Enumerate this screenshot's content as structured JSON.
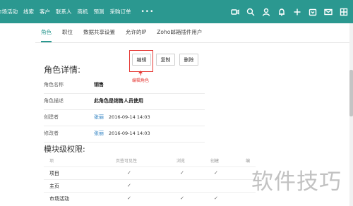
{
  "nav": {
    "items": [
      "市场活动",
      "线索",
      "客户",
      "联系人",
      "商机",
      "预测",
      "采购订单"
    ],
    "more": "•••",
    "icons": [
      "video-icon",
      "search-icon",
      "user-icon",
      "bell-icon",
      "plus-icon",
      "calendar-icon",
      "mail-icon",
      "grid-icon"
    ]
  },
  "tabs": [
    "角色",
    "职位",
    "数据共享设置",
    "允许的IP",
    "Zoho邮箱插件用户"
  ],
  "actions": {
    "edit": "编辑",
    "copy": "复制",
    "delete": "删除",
    "annotation": "编辑角色"
  },
  "details": {
    "title": "角色详情:",
    "rows": [
      {
        "label": "角色名称",
        "value": "销售"
      },
      {
        "label": "角色描述",
        "value": "此角色是销售人员使用"
      },
      {
        "label": "创建者",
        "user": "张丽",
        "date": "2016-09-14 14:03"
      },
      {
        "label": "修改者",
        "user": "张丽",
        "date": "2016-09-14 14:03"
      }
    ]
  },
  "modules": {
    "title": "模块级权限:",
    "headers": [
      "项",
      "页签可见性",
      "浏览",
      "创建",
      "编"
    ],
    "rows": [
      {
        "name": "项目",
        "checks": [
          true,
          true,
          true,
          false
        ]
      },
      {
        "name": "主页",
        "checks": [
          true,
          false,
          false,
          false
        ]
      },
      {
        "name": "市场活动",
        "checks": [
          true,
          true,
          true,
          false
        ]
      }
    ]
  },
  "watermark": "软件技巧",
  "colors": {
    "nav_bg": "#2b9890",
    "accent": "#2b9890",
    "highlight": "#e53935",
    "link": "#2b7fc1"
  }
}
